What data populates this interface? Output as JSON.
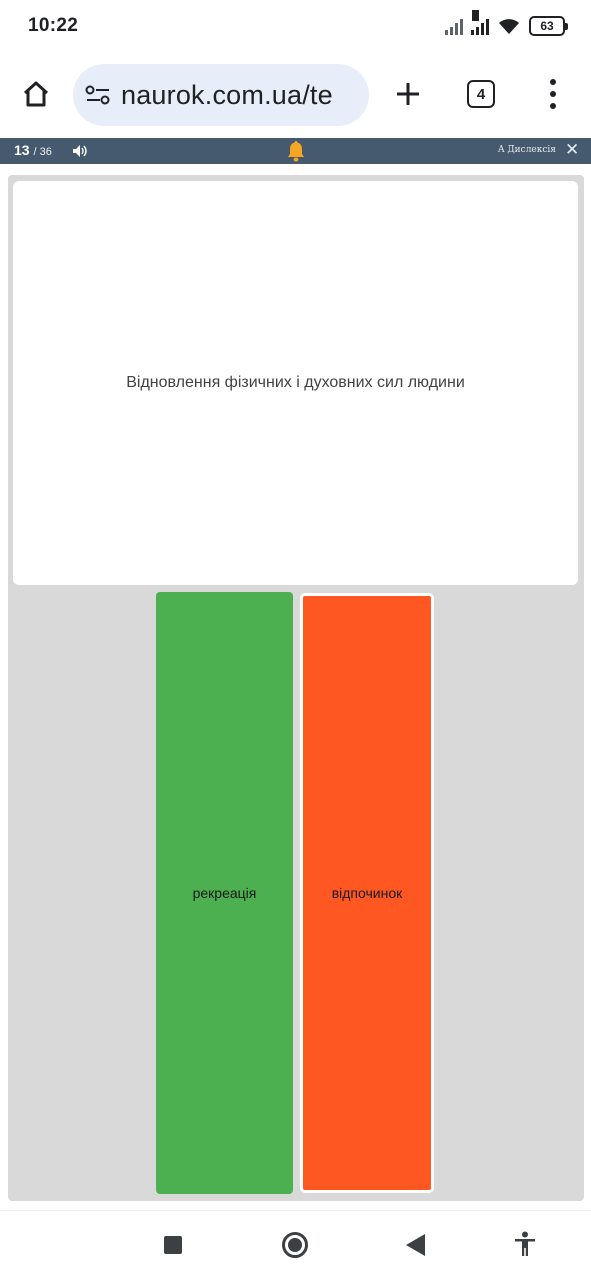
{
  "status_bar": {
    "time": "10:22",
    "signal_label": "R",
    "battery": "63"
  },
  "browser": {
    "url": "naurok.com.ua/te",
    "tab_count": "4"
  },
  "quiz_header": {
    "question_number": "13",
    "question_total": "/ 36",
    "dyslexia_label": "A Дислексія",
    "close_label": "✕"
  },
  "question": {
    "text": "Відновлення фізичних і духовних сил людини"
  },
  "options": [
    {
      "label": "",
      "color": "#d9d9d9"
    },
    {
      "label": "рекреація",
      "color": "#4caf50"
    },
    {
      "label": "відпочинок",
      "color": "#ff5722"
    },
    {
      "label": "",
      "color": "#d9d9d9"
    }
  ],
  "colors": {
    "quiz_header_bg": "#455a6e",
    "bell": "#f5a623",
    "url_bar_bg": "#e8eef9"
  }
}
